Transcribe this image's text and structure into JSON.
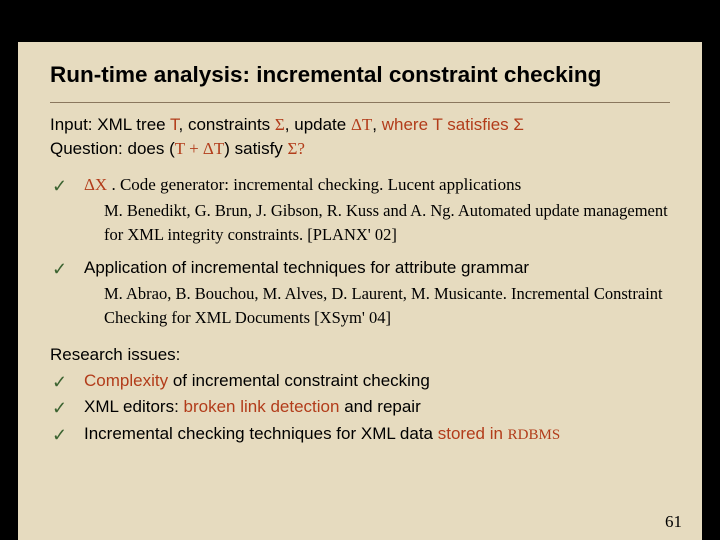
{
  "title": "Run-time analysis: incremental constraint checking",
  "intro": {
    "l1a": "Input:   XML tree ",
    "l1b": "T",
    "l1c": ", constraints ",
    "l1d": "Σ",
    "l1e": ", update ",
    "l1f": "ΔT",
    "l1g": ", ",
    "l1h": "where T satisfies Σ",
    "l2a": "Question: does (",
    "l2b": "T + ΔT",
    "l2c": ") satisfy ",
    "l2d": "Σ?"
  },
  "it1": {
    "lead": "ΔX",
    "rest": " . Code generator: incremental checking. Lucent applications",
    "cit": "M. Benedikt, G. Brun, J. Gibson, R. Kuss and A. Ng. Automated update management for XML integrity constraints. [PLANX' 02]"
  },
  "it2": {
    "lead": "Application of incremental techniques for attribute grammar",
    "cit": "M. Abrao, B. Bouchou, M. Alves, D. Laurent, M. Musicante. Incremental Constraint Checking for XML Documents [XSym' 04]"
  },
  "research": {
    "head": "Research issues:",
    "r1a": "Complexity",
    "r1b": " of incremental constraint checking",
    "r2a": "XML editors: ",
    "r2b": "broken link detection",
    "r2c": " and repair",
    "r3a": "Incremental checking techniques for XML data ",
    "r3b": "stored in ",
    "r3c": "RDBMS"
  },
  "icons": {
    "check": "✓"
  },
  "page": "61"
}
